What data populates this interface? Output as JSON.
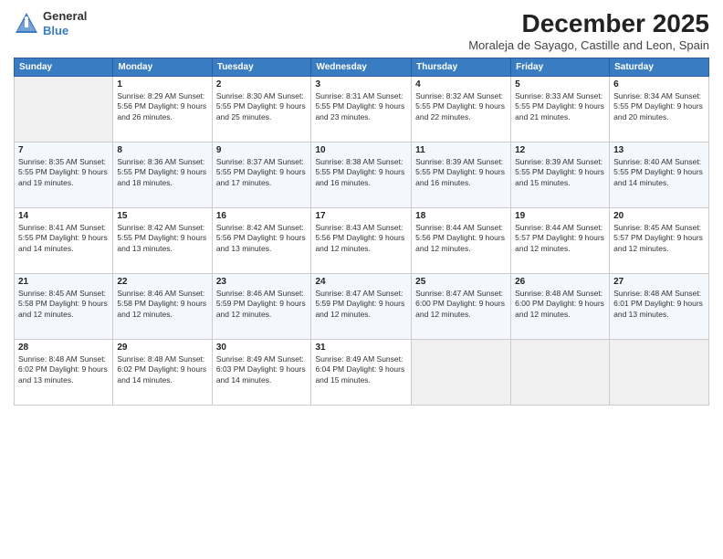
{
  "header": {
    "logo_general": "General",
    "logo_blue": "Blue",
    "month_title": "December 2025",
    "location": "Moraleja de Sayago, Castille and Leon, Spain"
  },
  "columns": [
    "Sunday",
    "Monday",
    "Tuesday",
    "Wednesday",
    "Thursday",
    "Friday",
    "Saturday"
  ],
  "weeks": [
    [
      {
        "day": "",
        "info": ""
      },
      {
        "day": "1",
        "info": "Sunrise: 8:29 AM\nSunset: 5:56 PM\nDaylight: 9 hours\nand 26 minutes."
      },
      {
        "day": "2",
        "info": "Sunrise: 8:30 AM\nSunset: 5:55 PM\nDaylight: 9 hours\nand 25 minutes."
      },
      {
        "day": "3",
        "info": "Sunrise: 8:31 AM\nSunset: 5:55 PM\nDaylight: 9 hours\nand 23 minutes."
      },
      {
        "day": "4",
        "info": "Sunrise: 8:32 AM\nSunset: 5:55 PM\nDaylight: 9 hours\nand 22 minutes."
      },
      {
        "day": "5",
        "info": "Sunrise: 8:33 AM\nSunset: 5:55 PM\nDaylight: 9 hours\nand 21 minutes."
      },
      {
        "day": "6",
        "info": "Sunrise: 8:34 AM\nSunset: 5:55 PM\nDaylight: 9 hours\nand 20 minutes."
      }
    ],
    [
      {
        "day": "7",
        "info": "Sunrise: 8:35 AM\nSunset: 5:55 PM\nDaylight: 9 hours\nand 19 minutes."
      },
      {
        "day": "8",
        "info": "Sunrise: 8:36 AM\nSunset: 5:55 PM\nDaylight: 9 hours\nand 18 minutes."
      },
      {
        "day": "9",
        "info": "Sunrise: 8:37 AM\nSunset: 5:55 PM\nDaylight: 9 hours\nand 17 minutes."
      },
      {
        "day": "10",
        "info": "Sunrise: 8:38 AM\nSunset: 5:55 PM\nDaylight: 9 hours\nand 16 minutes."
      },
      {
        "day": "11",
        "info": "Sunrise: 8:39 AM\nSunset: 5:55 PM\nDaylight: 9 hours\nand 16 minutes."
      },
      {
        "day": "12",
        "info": "Sunrise: 8:39 AM\nSunset: 5:55 PM\nDaylight: 9 hours\nand 15 minutes."
      },
      {
        "day": "13",
        "info": "Sunrise: 8:40 AM\nSunset: 5:55 PM\nDaylight: 9 hours\nand 14 minutes."
      }
    ],
    [
      {
        "day": "14",
        "info": "Sunrise: 8:41 AM\nSunset: 5:55 PM\nDaylight: 9 hours\nand 14 minutes."
      },
      {
        "day": "15",
        "info": "Sunrise: 8:42 AM\nSunset: 5:55 PM\nDaylight: 9 hours\nand 13 minutes."
      },
      {
        "day": "16",
        "info": "Sunrise: 8:42 AM\nSunset: 5:56 PM\nDaylight: 9 hours\nand 13 minutes."
      },
      {
        "day": "17",
        "info": "Sunrise: 8:43 AM\nSunset: 5:56 PM\nDaylight: 9 hours\nand 12 minutes."
      },
      {
        "day": "18",
        "info": "Sunrise: 8:44 AM\nSunset: 5:56 PM\nDaylight: 9 hours\nand 12 minutes."
      },
      {
        "day": "19",
        "info": "Sunrise: 8:44 AM\nSunset: 5:57 PM\nDaylight: 9 hours\nand 12 minutes."
      },
      {
        "day": "20",
        "info": "Sunrise: 8:45 AM\nSunset: 5:57 PM\nDaylight: 9 hours\nand 12 minutes."
      }
    ],
    [
      {
        "day": "21",
        "info": "Sunrise: 8:45 AM\nSunset: 5:58 PM\nDaylight: 9 hours\nand 12 minutes."
      },
      {
        "day": "22",
        "info": "Sunrise: 8:46 AM\nSunset: 5:58 PM\nDaylight: 9 hours\nand 12 minutes."
      },
      {
        "day": "23",
        "info": "Sunrise: 8:46 AM\nSunset: 5:59 PM\nDaylight: 9 hours\nand 12 minutes."
      },
      {
        "day": "24",
        "info": "Sunrise: 8:47 AM\nSunset: 5:59 PM\nDaylight: 9 hours\nand 12 minutes."
      },
      {
        "day": "25",
        "info": "Sunrise: 8:47 AM\nSunset: 6:00 PM\nDaylight: 9 hours\nand 12 minutes."
      },
      {
        "day": "26",
        "info": "Sunrise: 8:48 AM\nSunset: 6:00 PM\nDaylight: 9 hours\nand 12 minutes."
      },
      {
        "day": "27",
        "info": "Sunrise: 8:48 AM\nSunset: 6:01 PM\nDaylight: 9 hours\nand 13 minutes."
      }
    ],
    [
      {
        "day": "28",
        "info": "Sunrise: 8:48 AM\nSunset: 6:02 PM\nDaylight: 9 hours\nand 13 minutes."
      },
      {
        "day": "29",
        "info": "Sunrise: 8:48 AM\nSunset: 6:02 PM\nDaylight: 9 hours\nand 14 minutes."
      },
      {
        "day": "30",
        "info": "Sunrise: 8:49 AM\nSunset: 6:03 PM\nDaylight: 9 hours\nand 14 minutes."
      },
      {
        "day": "31",
        "info": "Sunrise: 8:49 AM\nSunset: 6:04 PM\nDaylight: 9 hours\nand 15 minutes."
      },
      {
        "day": "",
        "info": ""
      },
      {
        "day": "",
        "info": ""
      },
      {
        "day": "",
        "info": ""
      }
    ]
  ]
}
